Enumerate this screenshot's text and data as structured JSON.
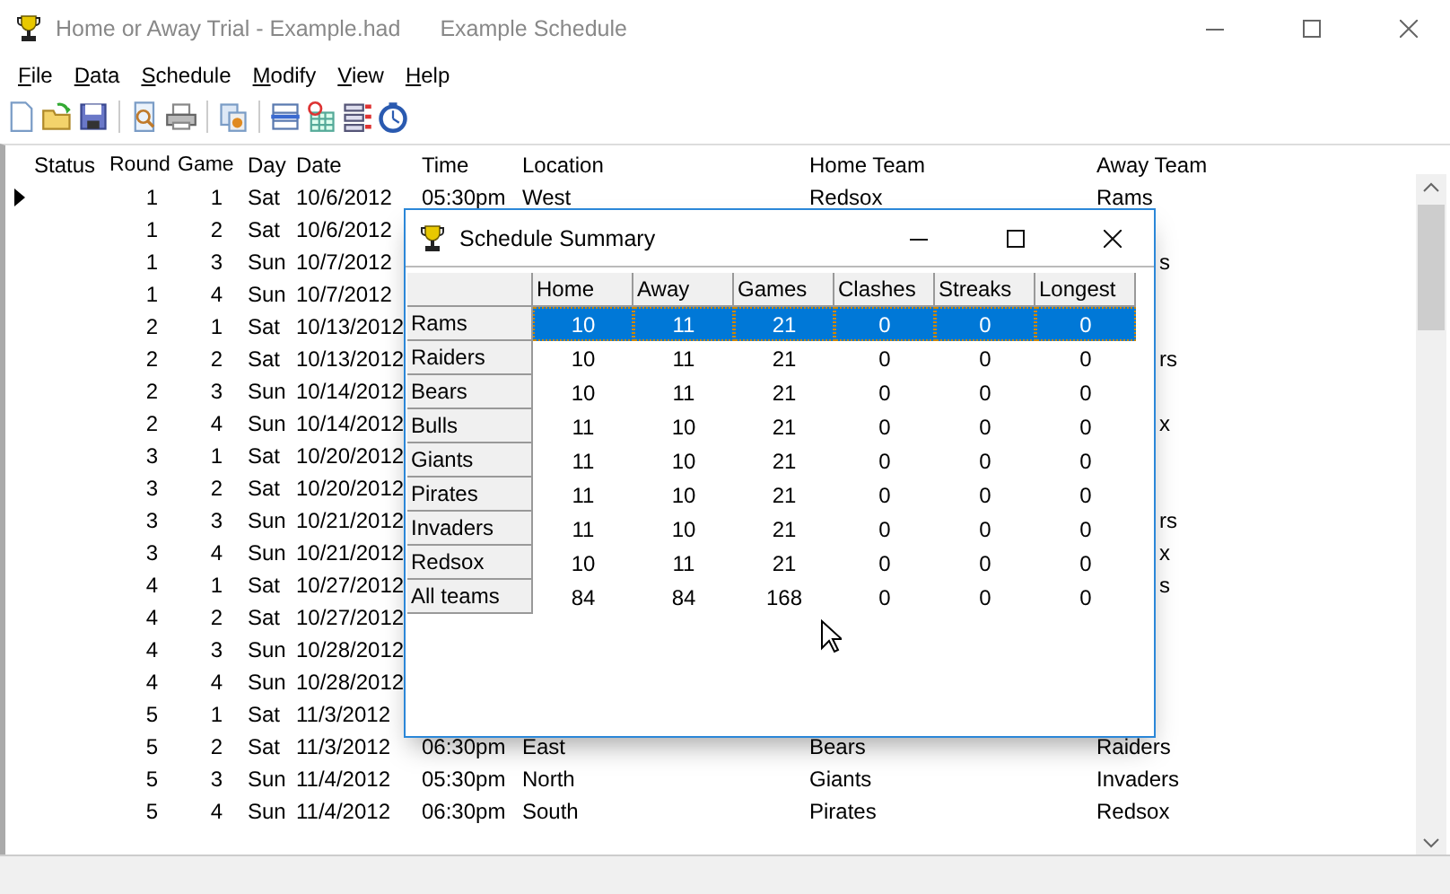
{
  "window": {
    "title": "Home or Away Trial - Example.had",
    "document": "Example Schedule"
  },
  "menu": [
    {
      "label": "File"
    },
    {
      "label": "Data"
    },
    {
      "label": "Schedule"
    },
    {
      "label": "Modify"
    },
    {
      "label": "View"
    },
    {
      "label": "Help"
    }
  ],
  "grid": {
    "columns": [
      "Status",
      "Round",
      "Game",
      "Day",
      "Date",
      "Time",
      "Location",
      "Home Team",
      "Away Team"
    ],
    "rows": [
      {
        "current": true,
        "round": "1",
        "game": "1",
        "day": "Sat",
        "date": "10/6/2012",
        "time": "05:30pm",
        "location": "West",
        "home": "Redsox",
        "away": "Rams"
      },
      {
        "current": false,
        "round": "1",
        "game": "2",
        "day": "Sat",
        "date": "10/6/2012"
      },
      {
        "current": false,
        "round": "1",
        "game": "3",
        "day": "Sun",
        "date": "10/7/2012",
        "away_peek": "s"
      },
      {
        "current": false,
        "round": "1",
        "game": "4",
        "day": "Sun",
        "date": "10/7/2012"
      },
      {
        "current": false,
        "round": "2",
        "game": "1",
        "day": "Sat",
        "date": "10/13/2012"
      },
      {
        "current": false,
        "round": "2",
        "game": "2",
        "day": "Sat",
        "date": "10/13/2012",
        "away_peek": "rs"
      },
      {
        "current": false,
        "round": "2",
        "game": "3",
        "day": "Sun",
        "date": "10/14/2012"
      },
      {
        "current": false,
        "round": "2",
        "game": "4",
        "day": "Sun",
        "date": "10/14/2012",
        "away_peek": "x"
      },
      {
        "current": false,
        "round": "3",
        "game": "1",
        "day": "Sat",
        "date": "10/20/2012"
      },
      {
        "current": false,
        "round": "3",
        "game": "2",
        "day": "Sat",
        "date": "10/20/2012"
      },
      {
        "current": false,
        "round": "3",
        "game": "3",
        "day": "Sun",
        "date": "10/21/2012",
        "away_peek": "rs"
      },
      {
        "current": false,
        "round": "3",
        "game": "4",
        "day": "Sun",
        "date": "10/21/2012",
        "away_peek": "x"
      },
      {
        "current": false,
        "round": "4",
        "game": "1",
        "day": "Sat",
        "date": "10/27/2012",
        "away_peek": "s"
      },
      {
        "current": false,
        "round": "4",
        "game": "2",
        "day": "Sat",
        "date": "10/27/2012"
      },
      {
        "current": false,
        "round": "4",
        "game": "3",
        "day": "Sun",
        "date": "10/28/2012"
      },
      {
        "current": false,
        "round": "4",
        "game": "4",
        "day": "Sun",
        "date": "10/28/2012"
      },
      {
        "current": false,
        "round": "5",
        "game": "1",
        "day": "Sat",
        "date": "11/3/2012"
      },
      {
        "current": false,
        "round": "5",
        "game": "2",
        "day": "Sat",
        "date": "11/3/2012",
        "time": "06:30pm",
        "location": "East",
        "home": "Bears",
        "away": "Raiders"
      },
      {
        "current": false,
        "round": "5",
        "game": "3",
        "day": "Sun",
        "date": "11/4/2012",
        "time": "05:30pm",
        "location": "North",
        "home": "Giants",
        "away": "Invaders"
      },
      {
        "current": false,
        "round": "5",
        "game": "4",
        "day": "Sun",
        "date": "11/4/2012",
        "time": "06:30pm",
        "location": "South",
        "home": "Pirates",
        "away": "Redsox"
      }
    ]
  },
  "dialog": {
    "title": "Schedule Summary",
    "columns": [
      "Home",
      "Away",
      "Games",
      "Clashes",
      "Streaks",
      "Longest"
    ],
    "rows": [
      {
        "team": "Rams",
        "selected": true,
        "values": [
          "10",
          "11",
          "21",
          "0",
          "0",
          "0"
        ]
      },
      {
        "team": "Raiders",
        "selected": false,
        "values": [
          "10",
          "11",
          "21",
          "0",
          "0",
          "0"
        ]
      },
      {
        "team": "Bears",
        "selected": false,
        "values": [
          "10",
          "11",
          "21",
          "0",
          "0",
          "0"
        ]
      },
      {
        "team": "Bulls",
        "selected": false,
        "values": [
          "11",
          "10",
          "21",
          "0",
          "0",
          "0"
        ]
      },
      {
        "team": "Giants",
        "selected": false,
        "values": [
          "11",
          "10",
          "21",
          "0",
          "0",
          "0"
        ]
      },
      {
        "team": "Pirates",
        "selected": false,
        "values": [
          "11",
          "10",
          "21",
          "0",
          "0",
          "0"
        ]
      },
      {
        "team": "Invaders",
        "selected": false,
        "values": [
          "11",
          "10",
          "21",
          "0",
          "0",
          "0"
        ]
      },
      {
        "team": "Redsox",
        "selected": false,
        "values": [
          "10",
          "11",
          "21",
          "0",
          "0",
          "0"
        ]
      },
      {
        "team": "All teams",
        "selected": false,
        "values": [
          "84",
          "84",
          "168",
          "0",
          "0",
          "0"
        ]
      }
    ]
  }
}
